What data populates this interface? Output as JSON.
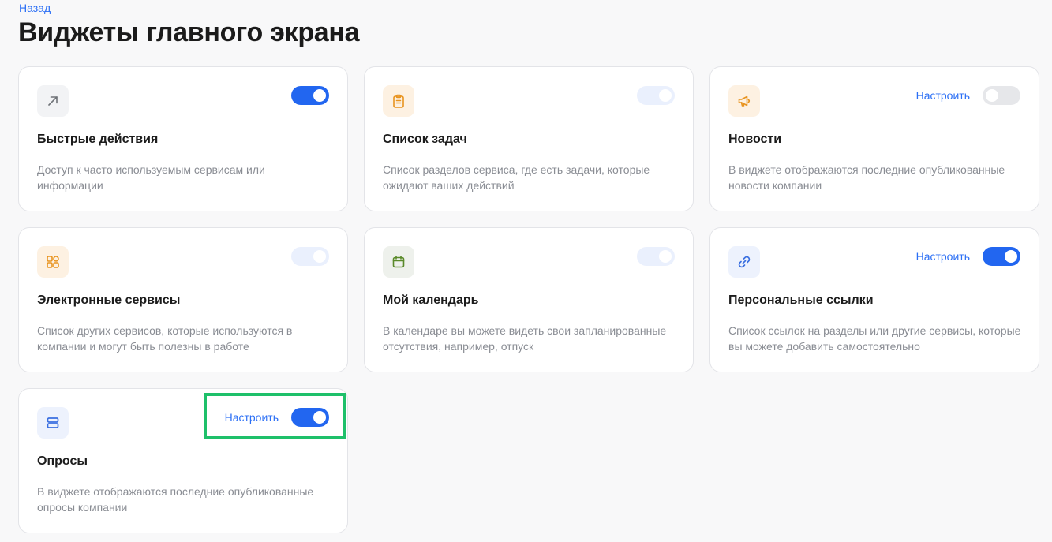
{
  "back_link": "Назад",
  "title": "Виджеты главного экрана",
  "configure_label": "Настроить",
  "widgets": [
    {
      "title": "Быстрые действия",
      "description": "Доступ к часто используемым сервисам или информации",
      "icon": "arrow-up-right-icon",
      "toggle": "on",
      "configurable": false
    },
    {
      "title": "Список задач",
      "description": "Список разделов сервиса, где есть задачи, которые ожидают ваших действий",
      "icon": "clipboard-list-icon",
      "toggle": "disabled-on",
      "configurable": false
    },
    {
      "title": "Новости",
      "description": "В виджете отображаются последние опубликованные новости компании",
      "icon": "megaphone-icon",
      "toggle": "off",
      "configurable": true
    },
    {
      "title": "Электронные сервисы",
      "description": "Список других сервисов, которые используются в компании и могут быть полезны в работе",
      "icon": "apps-grid-icon",
      "toggle": "disabled-on",
      "configurable": false
    },
    {
      "title": "Мой календарь",
      "description": "В календаре вы можете видеть свои запланированные отсутствия, например, отпуск",
      "icon": "calendar-icon",
      "toggle": "disabled-on",
      "configurable": false
    },
    {
      "title": "Персональные ссылки",
      "description": "Список ссылок на разделы или другие сервисы, которые вы можете добавить самостоятельно",
      "icon": "link-icon",
      "toggle": "on",
      "configurable": true
    },
    {
      "title": "Опросы",
      "description": "В виджете отображаются последние опубликованные опросы компании",
      "icon": "polls-icon",
      "toggle": "on",
      "configurable": true
    }
  ],
  "colors": {
    "accent": "#2266f0",
    "highlight": "#1ec06a",
    "icon_orange": "#e8931e",
    "icon_green": "#5a8a2a",
    "icon_blue": "#3a6fe0"
  }
}
